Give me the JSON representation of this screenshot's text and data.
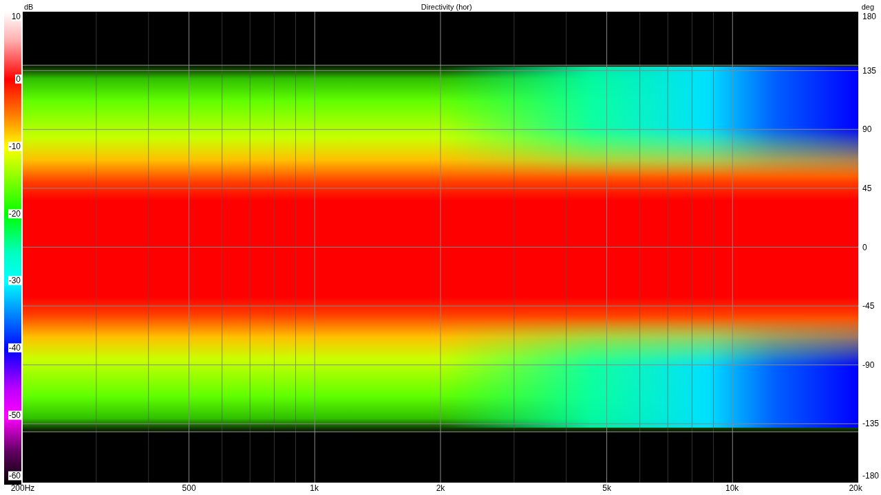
{
  "chart": {
    "title": "Directivity (hor)",
    "left_unit": "dB",
    "right_unit": "deg",
    "color_scale_labels": [
      "10",
      "0",
      "-10",
      "-20",
      "-30",
      "-40",
      "-50",
      "-60"
    ],
    "angle_labels": [
      "180",
      "135",
      "90",
      "45",
      "0",
      "-45",
      "-90",
      "-135",
      "-180"
    ],
    "frequency_labels": [
      "200Hz",
      "500",
      "1k",
      "2k",
      "5k",
      "10k",
      "20k"
    ]
  }
}
